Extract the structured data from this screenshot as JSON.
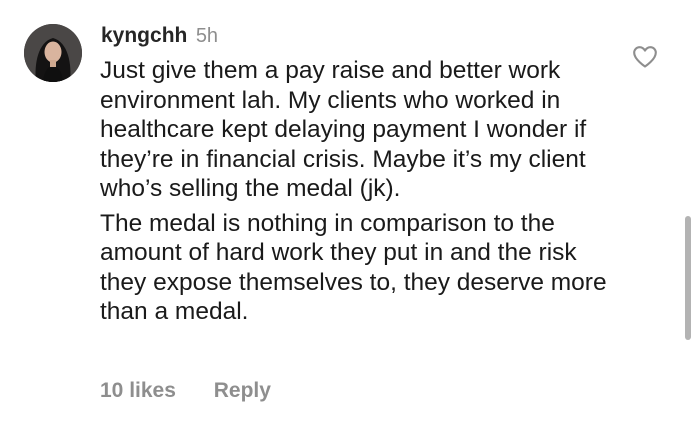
{
  "comment": {
    "username": "kyngchh",
    "timestamp": "5h",
    "paragraphs": [
      "Just give them a pay raise and better work environment lah. My clients who worked in healthcare kept delaying payment I wonder if they’re in financial crisis. Maybe it’s my client who’s selling the medal (jk).",
      "The medal is nothing in comparison to the amount of hard work they put in and the risk they expose themselves to, they deserve more than a medal."
    ],
    "likes_label": "10 likes",
    "reply_label": "Reply"
  },
  "icons": {
    "like": "heart-outline-icon",
    "avatar": "user-avatar"
  },
  "colors": {
    "text": "#1a1a1a",
    "username": "#262626",
    "muted": "#8e8e8e",
    "scrollbar": "#b3b3b3"
  }
}
